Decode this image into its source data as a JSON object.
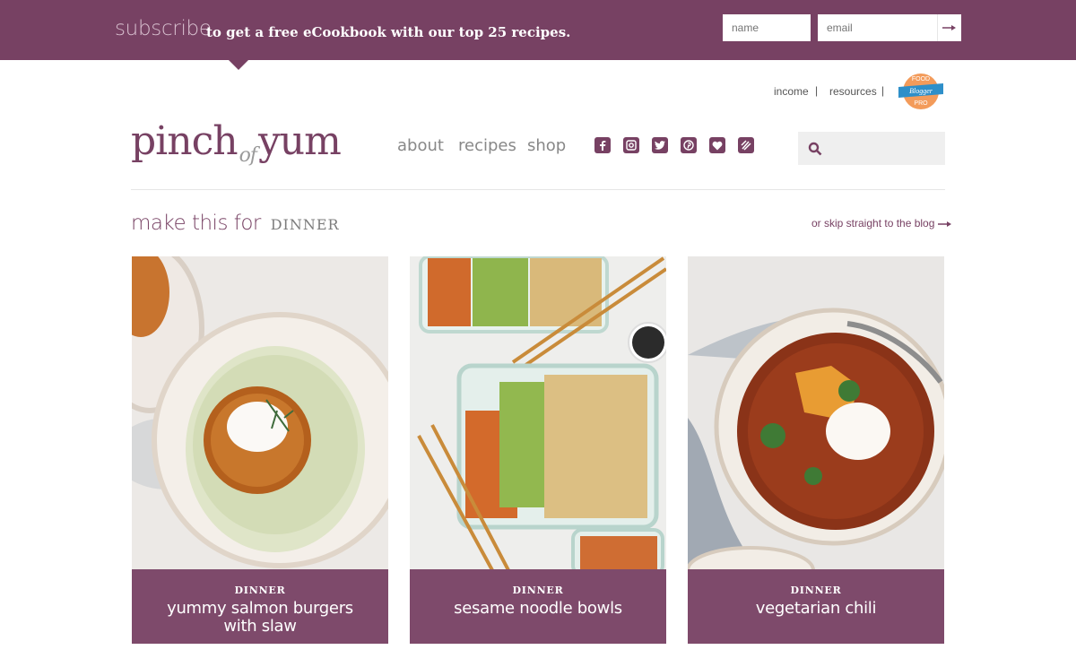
{
  "subscribe": {
    "word": "subscribe",
    "text": "to get a free eCookbook with our top 25 recipes.",
    "name_placeholder": "name",
    "email_placeholder": "email",
    "submit_icon": "arrow-right-icon"
  },
  "utility": {
    "links": [
      "income",
      "resources"
    ],
    "badge_lines": [
      "FOOD",
      "Blogger",
      "PRO"
    ]
  },
  "logo": {
    "part1": "pinch",
    "part2": "of",
    "part3": "yum"
  },
  "nav": {
    "items": [
      "about",
      "recipes",
      "shop"
    ]
  },
  "social": [
    "facebook-icon",
    "instagram-icon",
    "twitter-icon",
    "pinterest-icon",
    "bloglovin-icon",
    "food-icon"
  ],
  "search": {
    "icon": "search-icon",
    "placeholder": ""
  },
  "section": {
    "prefix": "make this for",
    "category": "DINNER",
    "skip_link": "or skip straight to the blog"
  },
  "cards": [
    {
      "category": "DINNER",
      "title": "yummy salmon burgers with slaw"
    },
    {
      "category": "DINNER",
      "title": "sesame noodle bowls"
    },
    {
      "category": "DINNER",
      "title": "vegetarian chili"
    }
  ],
  "colors": {
    "brand": "#774163",
    "caption": "#7e4a6b"
  }
}
